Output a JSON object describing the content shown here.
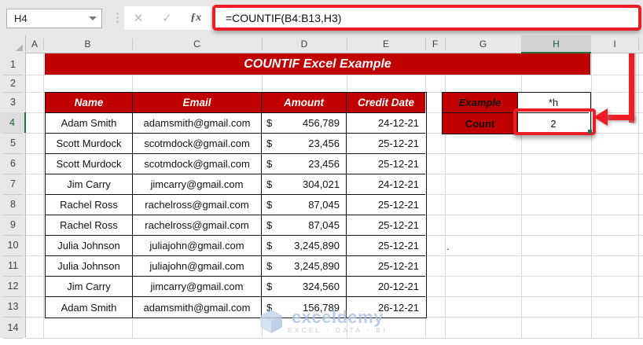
{
  "name_box": {
    "value": "H4"
  },
  "formula_bar": {
    "formula": "=COUNTIF(B4:B13,H3)"
  },
  "icons": {
    "cancel": "✕",
    "enter": "✓",
    "fx": "ƒx",
    "more_dots": "⋮"
  },
  "grid": {
    "column_headers": [
      "A",
      "B",
      "C",
      "D",
      "E",
      "F",
      "G",
      "H",
      "I"
    ],
    "row_headers": [
      "1",
      "2",
      "3",
      "4",
      "5",
      "6",
      "7",
      "8",
      "9",
      "10",
      "11",
      "12",
      "13",
      "14"
    ],
    "selected_cell": "H4"
  },
  "title_banner": {
    "text": "COUNTIF Excel Example"
  },
  "data_table": {
    "headers": {
      "name": "Name",
      "email": "Email",
      "amount": "Amount",
      "credit_date": "Credit Date"
    },
    "currency_symbol": "$",
    "rows": [
      {
        "name": "Adam Smith",
        "email": "adamsmith@gmail.com",
        "amount": "456,789",
        "credit_date": "24-12-21"
      },
      {
        "name": "Scott Murdock",
        "email": "scotmdock@gmail.com",
        "amount": "23,456",
        "credit_date": "25-12-21"
      },
      {
        "name": "Scott Murdock",
        "email": "scotmdock@gmail.com",
        "amount": "23,456",
        "credit_date": "25-12-21"
      },
      {
        "name": "Jim Carry",
        "email": "jimcarry@gmail.com",
        "amount": "304,021",
        "credit_date": "24-12-21"
      },
      {
        "name": "Rachel Ross",
        "email": "rachelross@gmail.com",
        "amount": "87,045",
        "credit_date": "25-12-21"
      },
      {
        "name": "Rachel Ross",
        "email": "rachelross@gmail.com",
        "amount": "87,045",
        "credit_date": "25-12-21"
      },
      {
        "name": "Julia Johnson",
        "email": "juliajohn@gmail.com",
        "amount": "3,245,890",
        "credit_date": "25-12-21"
      },
      {
        "name": "Julia Johnson",
        "email": "juliajohn@gmail.com",
        "amount": "3,245,890",
        "credit_date": "25-12-21"
      },
      {
        "name": "Jim Carry",
        "email": "jimcarry@gmail.com",
        "amount": "324,560",
        "credit_date": "20-12-21"
      },
      {
        "name": "Adam Smith",
        "email": "adamsmith@gmail.com",
        "amount": "156,789",
        "credit_date": "26-12-21"
      }
    ]
  },
  "example_table": {
    "example_label": "Example",
    "example_value": "*h",
    "count_label": "Count",
    "count_value": "2"
  },
  "stray_cell": {
    "text": "."
  },
  "watermark": {
    "brand": "exceldemy",
    "tagline": "EXCEL - DATA - BI"
  },
  "colors": {
    "fill_dark_red": "#c00000",
    "highlight_red": "#ee1c25",
    "selection_green": "#217346"
  }
}
